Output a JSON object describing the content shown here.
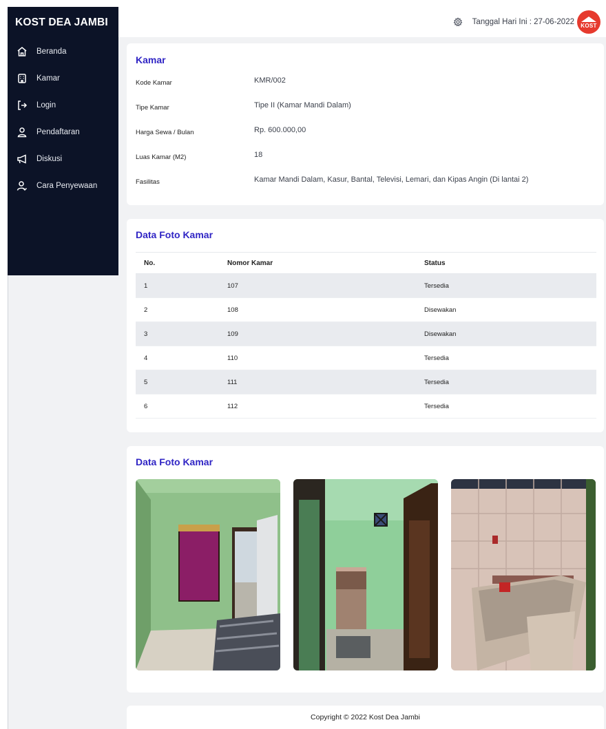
{
  "sidebar": {
    "brand": "KOST DEA JAMBI",
    "items": [
      {
        "label": "Beranda",
        "icon": "home-icon"
      },
      {
        "label": "Kamar",
        "icon": "building-icon"
      },
      {
        "label": "Login",
        "icon": "login-icon"
      },
      {
        "label": "Pendaftaran",
        "icon": "user-icon"
      },
      {
        "label": "Diskusi",
        "icon": "megaphone-icon"
      },
      {
        "label": "Cara Penyewaan",
        "icon": "user-check-icon"
      }
    ]
  },
  "topbar": {
    "date_text": "Tanggal Hari Ini : 27-06-2022",
    "logo_text": "KOST"
  },
  "kamar": {
    "title": "Kamar",
    "rows": [
      {
        "label": "Kode Kamar",
        "value": "KMR/002"
      },
      {
        "label": "Tipe Kamar",
        "value": "Tipe II (Kamar Mandi Dalam)"
      },
      {
        "label": "Harga Sewa / Bulan",
        "value": "Rp. 600.000,00"
      },
      {
        "label": "Luas Kamar (M2)",
        "value": "18"
      },
      {
        "label": "Fasilitas",
        "value": "Kamar Mandi Dalam, Kasur, Bantal, Televisi, Lemari, dan Kipas Angin (Di lantai 2)"
      }
    ]
  },
  "rooms_table": {
    "title": "Data Foto Kamar",
    "headers": [
      "No.",
      "Nomor Kamar",
      "Status"
    ],
    "rows": [
      [
        "1",
        "107",
        "Tersedia"
      ],
      [
        "2",
        "108",
        "Disewakan"
      ],
      [
        "3",
        "109",
        "Disewakan"
      ],
      [
        "4",
        "110",
        "Tersedia"
      ],
      [
        "5",
        "111",
        "Tersedia"
      ],
      [
        "6",
        "112",
        "Tersedia"
      ]
    ]
  },
  "photos": {
    "title": "Data Foto Kamar"
  },
  "footer": {
    "text": "Copyright © 2022 Kost Dea Jambi"
  },
  "colors": {
    "sidebar_bg": "#0c1327",
    "accent_title": "#2f24c4",
    "logo_red": "#e63a2e",
    "page_bg": "#f1f2f4",
    "row_stripe": "#e9ebef"
  }
}
